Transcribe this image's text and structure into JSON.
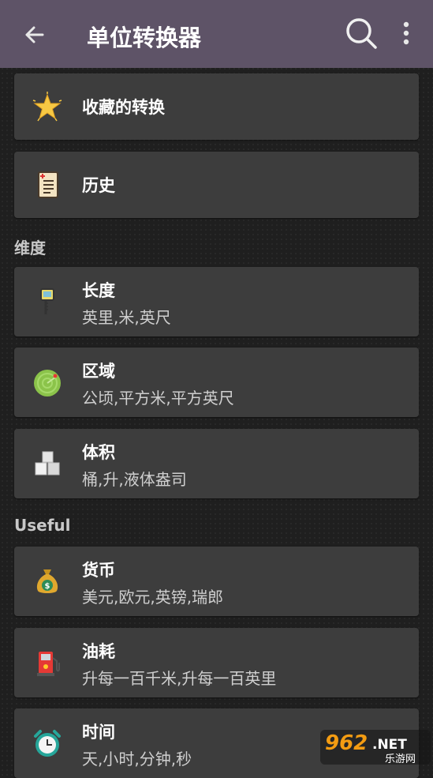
{
  "appbar": {
    "title": "单位转换器"
  },
  "favorites": {
    "label": "收藏的转换"
  },
  "history": {
    "label": "历史"
  },
  "sections": {
    "dimension": "维度",
    "useful": "Useful"
  },
  "items": {
    "length": {
      "title": "长度",
      "subtitle": "英里,米,英尺"
    },
    "area": {
      "title": "区域",
      "subtitle": "公顷,平方米,平方英尺"
    },
    "volume": {
      "title": "体积",
      "subtitle": "桶,升,液体盎司"
    },
    "currency": {
      "title": "货币",
      "subtitle": "美元,欧元,英镑,瑞郎"
    },
    "fuel": {
      "title": "油耗",
      "subtitle": "升每一百千米,升每一百英里"
    },
    "time": {
      "title": "时间",
      "subtitle": "天,小时,分钟,秒"
    }
  },
  "watermark": {
    "main": "962",
    "suffix": ".NET",
    "sub": "乐游网"
  },
  "colors": {
    "appbar": "#5e5367",
    "card": "#3d3d3d",
    "background": "#1f1f1f"
  }
}
